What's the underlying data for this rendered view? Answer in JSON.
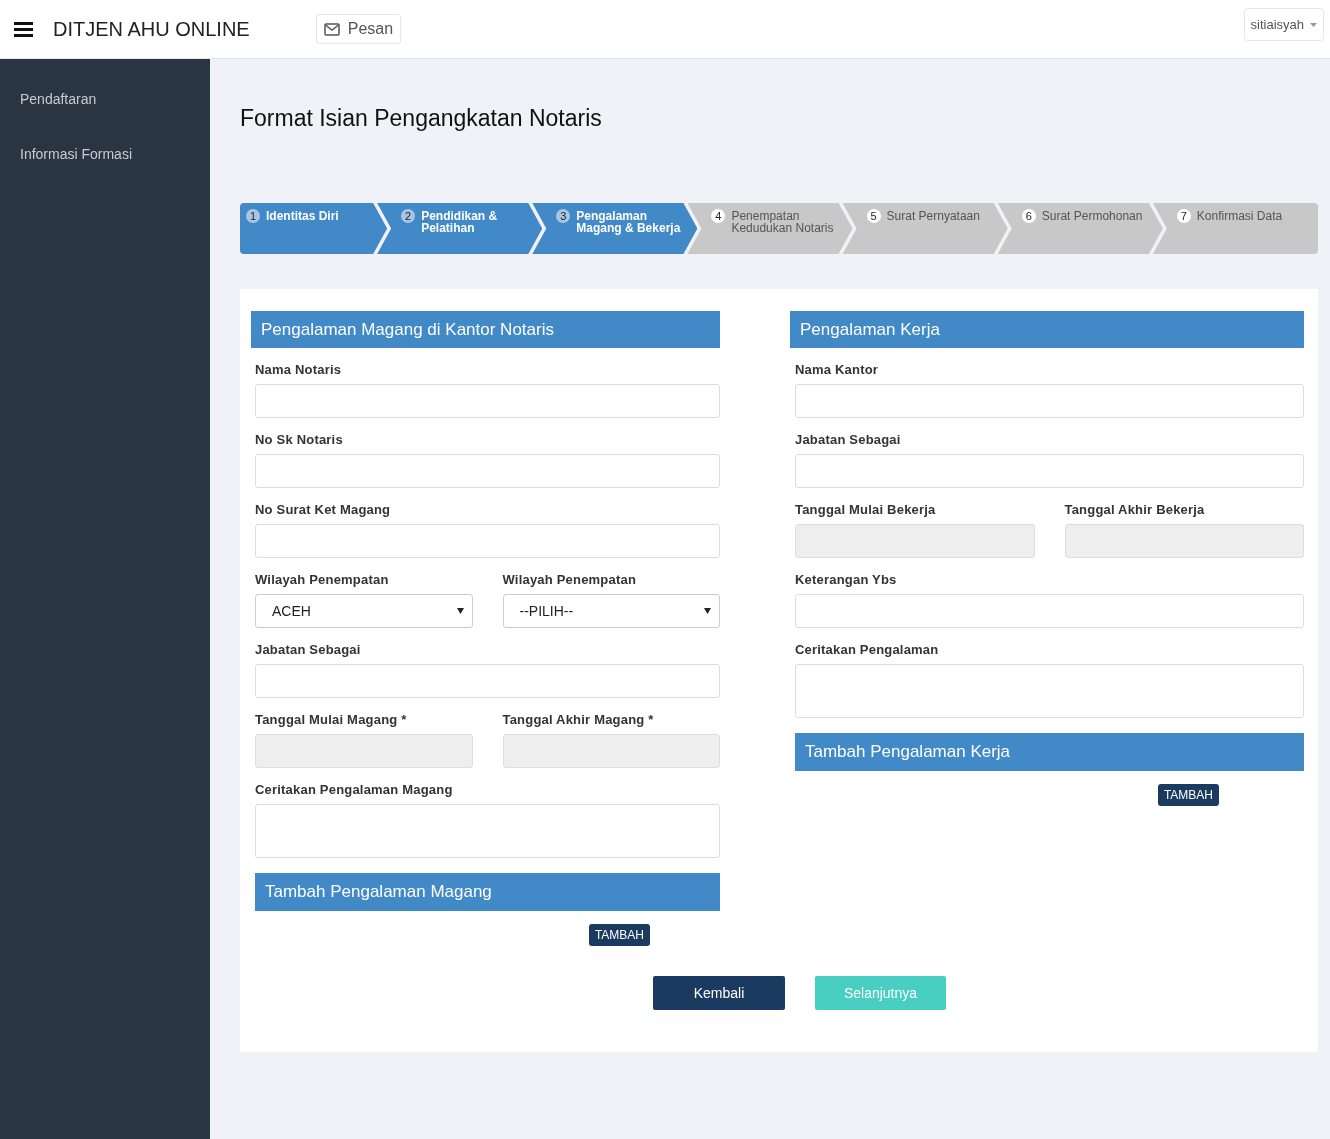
{
  "header": {
    "brand": "DITJEN AHU ONLINE",
    "message_button": "Pesan",
    "user": "sitiaisyah"
  },
  "sidebar": {
    "items": [
      {
        "label": "Pendaftaran"
      },
      {
        "label": "Informasi Formasi"
      }
    ]
  },
  "page_title": "Format Isian Pengangkatan Notaris",
  "steps": [
    {
      "number": "1",
      "label": "Identitas Diri",
      "completed": true
    },
    {
      "number": "2",
      "label": "Pendidikan & Pelatihan",
      "completed": true
    },
    {
      "number": "3",
      "label": "Pengalaman Magang & Bekerja",
      "completed": true
    },
    {
      "number": "4",
      "label": "Penempatan Kedudukan Notaris",
      "completed": false
    },
    {
      "number": "5",
      "label": "Surat Pernyataan",
      "completed": false
    },
    {
      "number": "6",
      "label": "Surat Permohonan",
      "completed": false
    },
    {
      "number": "7",
      "label": "Konfirmasi Data",
      "completed": false
    }
  ],
  "sections": [
    {
      "title": "Pengalaman Magang di Kantor Notaris",
      "rows": [
        [
          {
            "kind": "text",
            "label": "Nama Notaris"
          }
        ],
        [
          {
            "kind": "text",
            "label": "No Sk Notaris"
          }
        ],
        [
          {
            "kind": "text",
            "label": "No Surat Ket Magang"
          }
        ],
        [
          {
            "kind": "select",
            "label": "Wilayah Penempatan",
            "value": "ACEH"
          },
          {
            "kind": "select",
            "label": "Wilayah Penempatan",
            "value": "--PILIH--"
          }
        ],
        [
          {
            "kind": "text",
            "label": "Jabatan Sebagai"
          }
        ],
        [
          {
            "kind": "date",
            "label": "Tanggal Mulai Magang",
            "required_mark": "*"
          },
          {
            "kind": "date",
            "label": "Tanggal Akhir Magang",
            "required_mark": "*"
          }
        ],
        [
          {
            "kind": "textarea",
            "label": "Ceritakan Pengalaman Magang"
          }
        ]
      ],
      "add_title": "Tambah Pengalaman Magang",
      "add_button": "TAMBAH"
    },
    {
      "title": "Pengalaman Kerja",
      "rows": [
        [
          {
            "kind": "text",
            "label": "Nama Kantor"
          }
        ],
        [
          {
            "kind": "text",
            "label": "Jabatan Sebagai"
          }
        ],
        [
          {
            "kind": "date",
            "label": "Tanggal Mulai Bekerja"
          },
          {
            "kind": "date",
            "label": "Tanggal Akhir Bekerja"
          }
        ],
        [
          {
            "kind": "text",
            "label": "Keterangan Ybs"
          }
        ],
        [
          {
            "kind": "textarea",
            "label": "Ceritakan Pengalaman"
          }
        ]
      ],
      "add_title": "Tambah Pengalaman Kerja",
      "add_button": "TAMBAH"
    }
  ],
  "buttons": {
    "back": "Kembali",
    "next": "Selanjutnya"
  }
}
